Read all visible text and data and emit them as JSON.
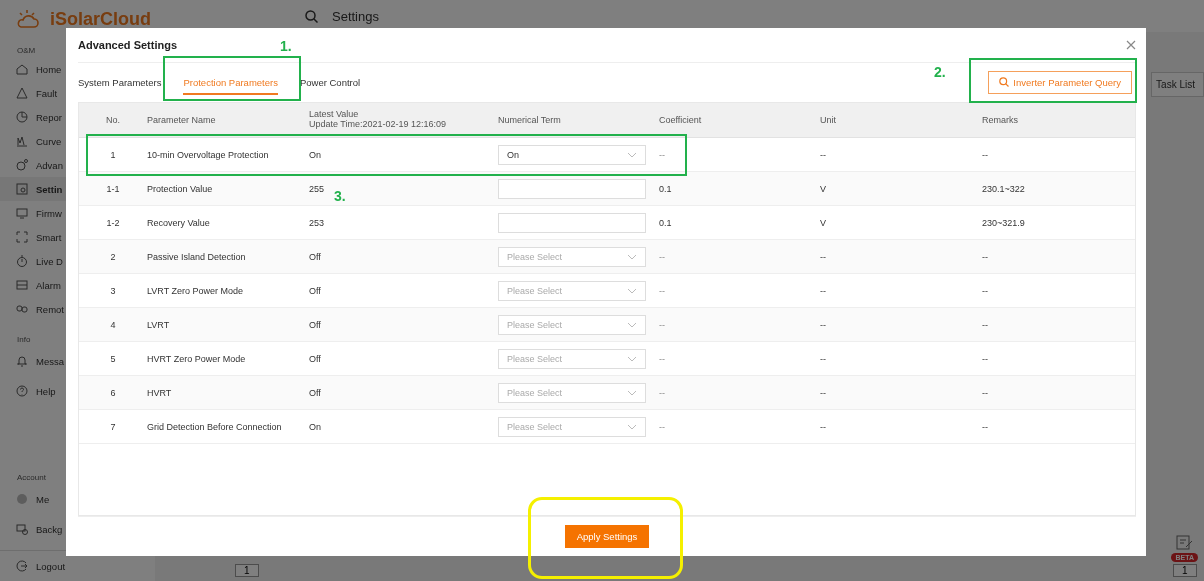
{
  "app": {
    "logo_text": "iSolarCloud",
    "page_title": "Settings",
    "task_list_button": "Task List",
    "pagination_page": "1",
    "right_page_box": "1",
    "beta_badge": "BETA",
    "sidebar": [
      {
        "section": "O&M",
        "items": [
          {
            "label": "Home",
            "selected": false
          },
          {
            "label": "Fault",
            "selected": false
          },
          {
            "label": "Repor",
            "selected": false
          },
          {
            "label": "Curve",
            "selected": false
          },
          {
            "label": "Advan",
            "selected": false
          },
          {
            "label": "Settin",
            "selected": true
          },
          {
            "label": "Firmw",
            "selected": false
          },
          {
            "label": "Smart",
            "selected": false
          },
          {
            "label": "Live D",
            "selected": false
          },
          {
            "label": "Alarm",
            "selected": false
          },
          {
            "label": "Remot",
            "selected": false
          }
        ]
      },
      {
        "section": "Info",
        "items": [
          {
            "label": "Messa",
            "selected": false
          },
          {
            "label": "Help",
            "selected": false
          }
        ]
      },
      {
        "section": "Account",
        "items": [
          {
            "label": "Me",
            "selected": false
          },
          {
            "label": "Backg",
            "selected": false
          }
        ]
      }
    ],
    "logout": "Logout"
  },
  "dialog": {
    "title": "Advanced Settings",
    "tabs": [
      {
        "label": "System Parameters",
        "selected": false
      },
      {
        "label": "Protection Parameters",
        "selected": true
      },
      {
        "label": "Power Control",
        "selected": false
      }
    ],
    "query_button": "Inverter Parameter Query",
    "columns": [
      "No.",
      "Parameter Name",
      "Latest Value",
      "Numerical Term",
      "Coefficient",
      "Unit",
      "Remarks"
    ],
    "update_time": "Update Time:2021-02-19 12:16:09",
    "rows": [
      {
        "no": "1",
        "name": "10-min Overvoltage Protection",
        "latest": "On",
        "kind": "select",
        "value": "On",
        "coefficient": "--",
        "unit": "--",
        "remarks": "--"
      },
      {
        "no": "1-1",
        "name": "Protection Value",
        "latest": "255",
        "kind": "input",
        "coefficient": "0.1",
        "unit": "V",
        "remarks": "230.1~322"
      },
      {
        "no": "1-2",
        "name": "Recovery Value",
        "latest": "253",
        "kind": "input",
        "coefficient": "0.1",
        "unit": "V",
        "remarks": "230~321.9"
      },
      {
        "no": "2",
        "name": "Passive Island Detection",
        "latest": "Off",
        "kind": "select",
        "placeholder": "Please Select",
        "coefficient": "--",
        "unit": "--",
        "remarks": "--"
      },
      {
        "no": "3",
        "name": "LVRT Zero Power Mode",
        "latest": "Off",
        "kind": "select",
        "placeholder": "Please Select",
        "coefficient": "--",
        "unit": "--",
        "remarks": "--"
      },
      {
        "no": "4",
        "name": "LVRT",
        "latest": "Off",
        "kind": "select",
        "placeholder": "Please Select",
        "coefficient": "--",
        "unit": "--",
        "remarks": "--"
      },
      {
        "no": "5",
        "name": "HVRT Zero Power Mode",
        "latest": "Off",
        "kind": "select",
        "placeholder": "Please Select",
        "coefficient": "--",
        "unit": "--",
        "remarks": "--"
      },
      {
        "no": "6",
        "name": "HVRT",
        "latest": "Off",
        "kind": "select",
        "placeholder": "Please Select",
        "coefficient": "--",
        "unit": "--",
        "remarks": "--"
      },
      {
        "no": "7",
        "name": "Grid Detection Before Connection",
        "latest": "On",
        "kind": "select",
        "placeholder": "Please Select",
        "coefficient": "--",
        "unit": "--",
        "remarks": "--"
      }
    ],
    "apply_button": "Apply Settings"
  },
  "annotations": [
    {
      "label": "1."
    },
    {
      "label": "2."
    },
    {
      "label": "3."
    }
  ]
}
